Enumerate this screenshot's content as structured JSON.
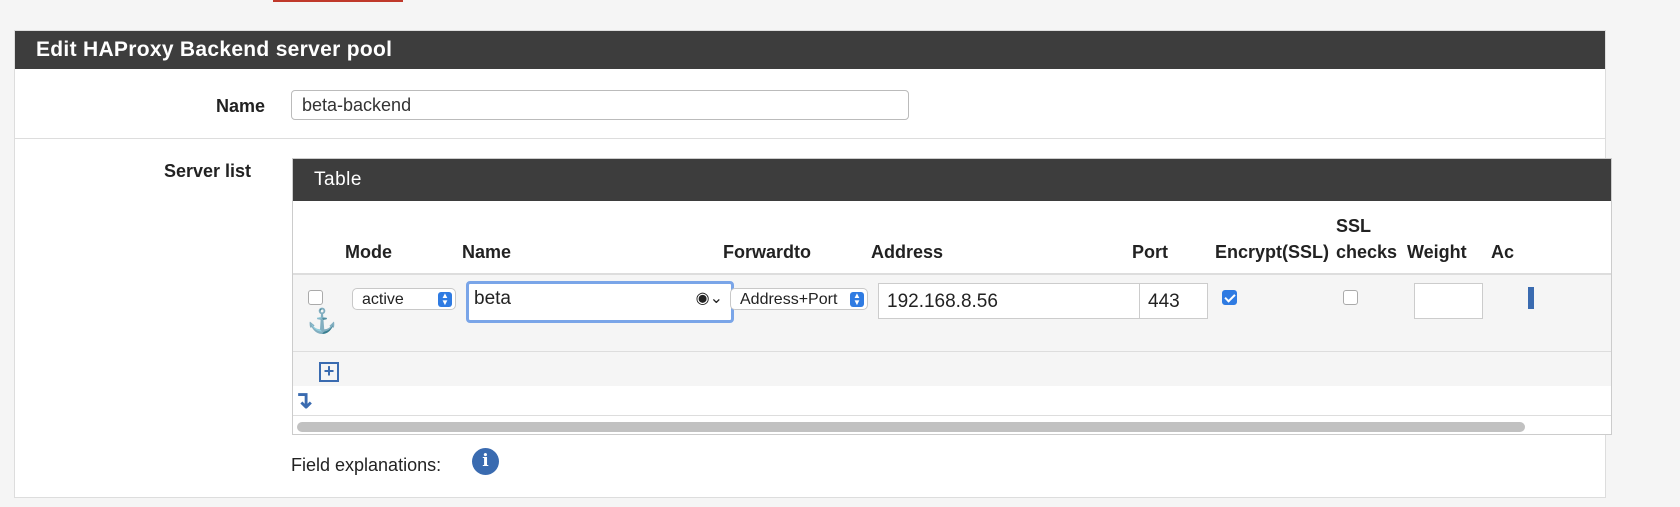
{
  "panel": {
    "title": "Edit HAProxy Backend server pool"
  },
  "name_field": {
    "label": "Name",
    "value": "beta-backend"
  },
  "server_list": {
    "label": "Server list",
    "table_title": "Table",
    "headers": {
      "mode": "Mode",
      "name": "Name",
      "forwardto": "Forwardto",
      "address": "Address",
      "port": "Port",
      "encrypt": "Encrypt(SSL)",
      "ssl_checks_line1": "SSL",
      "ssl_checks_line2": "checks",
      "weight": "Weight",
      "actions": "Ac"
    },
    "row": {
      "selected": false,
      "mode": "active",
      "name": "beta",
      "forwardto": "Address+Port",
      "address": "192.168.8.56",
      "port": "443",
      "encrypt_ssl": true,
      "ssl_checks": false,
      "weight": ""
    }
  },
  "field_explanations": {
    "label": "Field explanations:"
  },
  "icons": {
    "anchor": "anchor-icon",
    "add": "plus-square-icon",
    "move": "arrow-down-icon",
    "info": "info-icon",
    "trash": "trash-icon",
    "contact": "contact-icon"
  },
  "colors": {
    "header_bg": "#3d3d3d",
    "accent": "#3a6bb0",
    "checkbox": "#2f7be2"
  }
}
